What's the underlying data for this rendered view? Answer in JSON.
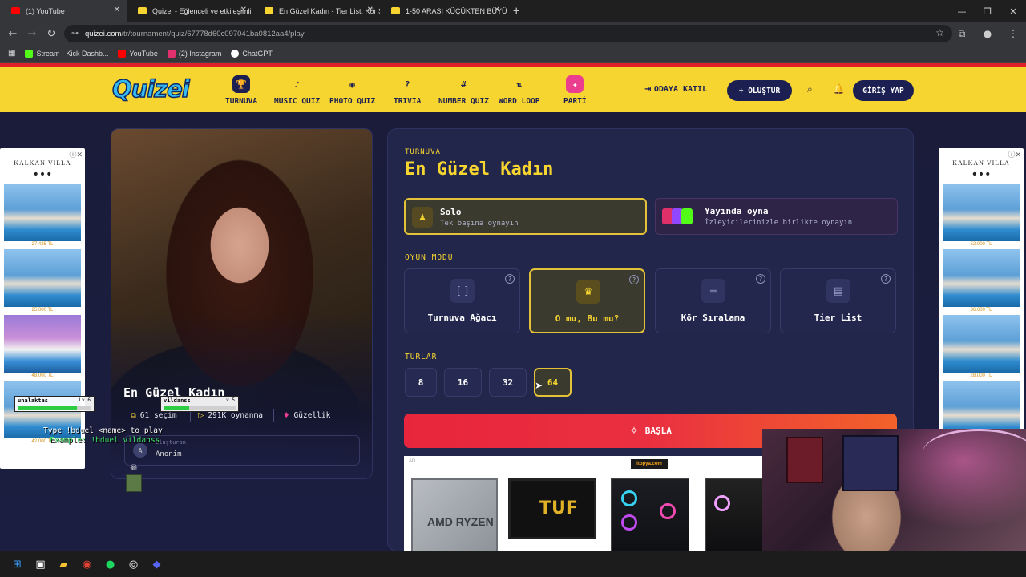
{
  "browser": {
    "tabs": [
      {
        "title": "(1) YouTube",
        "color": "#ff0000"
      },
      {
        "title": "Quizei - Eğlenceli ve etkileşimli",
        "color": "#f7d530"
      },
      {
        "title": "En Güzel Kadın - Tier List, Kör S",
        "color": "#f7d530"
      },
      {
        "title": "1-50 ARASI KÜÇÜKTEN BÜYÜĞ",
        "color": "#f7d530"
      }
    ],
    "url_host": "quizei.com",
    "url_path": "/tr/tournament/quiz/67778d60c097041ba0812aa4/play",
    "bookmarks": [
      {
        "label": "Stream - Kick Dashb...",
        "color": "#53fc18"
      },
      {
        "label": "YouTube",
        "color": "#ff0000"
      },
      {
        "label": "(2) Instagram",
        "color": "#e1306c"
      },
      {
        "label": "ChatGPT",
        "color": "#ffffff"
      }
    ]
  },
  "site": {
    "logo": "Quizei",
    "nav": [
      {
        "label": "TURNUVA",
        "icon": "trophy-icon",
        "glyph": "🏆"
      },
      {
        "label": "MUSIC QUIZ",
        "icon": "music-note-icon",
        "glyph": "♪"
      },
      {
        "label": "PHOTO QUIZ",
        "icon": "camera-icon",
        "glyph": "◉"
      },
      {
        "label": "TRIVIA",
        "icon": "question-bubble-icon",
        "glyph": "?"
      },
      {
        "label": "NUMBER QUIZ",
        "icon": "hash-icon",
        "glyph": "#"
      },
      {
        "label": "WORD LOOP",
        "icon": "sort-icon",
        "glyph": "⇅"
      },
      {
        "label": "PARTİ",
        "icon": "party-icon",
        "glyph": "✦"
      }
    ],
    "join_label": "ODAYA KATIL",
    "create_label": "+ OLUŞTUR",
    "login_label": "GİRİŞ YAP"
  },
  "quiz_card": {
    "title": "En Güzel Kadın",
    "choices": "61 seçim",
    "plays": "291K oynanma",
    "category": "Güzellik",
    "author_label": "Oluşturan",
    "author_name": "Anonim",
    "author_initial": "A"
  },
  "panel": {
    "kicker": "TURNUVA",
    "title": "En Güzel Kadın",
    "modes": [
      {
        "title": "Solo",
        "subtitle": "Tek başına oynayın"
      },
      {
        "title": "Yayında oyna",
        "subtitle": "İzleyicilerinizle birlikte oynayın"
      }
    ],
    "game_mode_label": "OYUN MODU",
    "game_modes": [
      {
        "label": "Turnuva Ağacı",
        "glyph": "[ ]"
      },
      {
        "label": "O mu, Bu mu?",
        "glyph": "♛"
      },
      {
        "label": "Kör Sıralama",
        "glyph": "≡"
      },
      {
        "label": "Tier List",
        "glyph": "▤"
      }
    ],
    "rounds_label": "TURLAR",
    "rounds": [
      "8",
      "16",
      "32",
      "64"
    ],
    "selected_round": "64",
    "start_label": "BAŞLA"
  },
  "ads": {
    "side_brand": "KALKAN VILLA",
    "left_prices": [
      "27.425 TL",
      "25.000 TL",
      "48.000 TL",
      "42.000 TL"
    ],
    "right_prices": [
      "52.000 TL",
      "36.000 TL",
      "28.000 TL"
    ],
    "bottom_label": "AD",
    "bottom_logo": "itopya.com",
    "cpu_text": "AMD RYZEN",
    "monitor_text": "TUF"
  },
  "overlay": {
    "player1": "unalaktas",
    "player1_level": "Lv.6",
    "player2": "vildanss",
    "player2_level": "Lv.5",
    "hp_label": "HP:",
    "hint1": "Type !bduel <name> to play",
    "hint2": "Example: !bduel vildanss",
    "player1_hp": 0.8,
    "player2_hp": 0.35
  }
}
